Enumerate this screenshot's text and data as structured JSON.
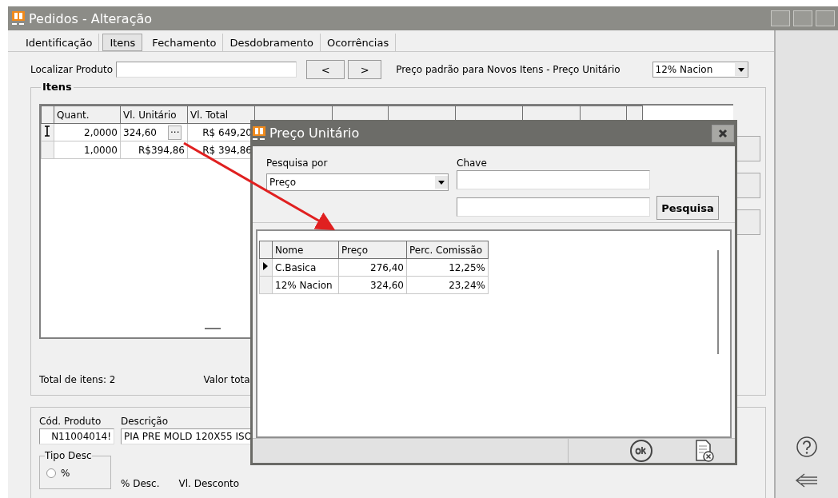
{
  "window": {
    "title": "Pedidos - Alteração"
  },
  "tabs": [
    {
      "label": "Identificação",
      "selected": false
    },
    {
      "label": "Itens",
      "selected": true
    },
    {
      "label": "Fechamento",
      "selected": false
    },
    {
      "label": "Desdobramento",
      "selected": false
    },
    {
      "label": "Ocorrências",
      "selected": false
    }
  ],
  "search": {
    "label": "Localizar Produto",
    "prev": "<",
    "next": ">",
    "price_label": "Preço padrão para Novos Itens - Preço Unitário",
    "price_value": "12% Nacion"
  },
  "items": {
    "title": "Itens",
    "columns": [
      "Quant.",
      "Vl. Unitário",
      "Vl. Total"
    ],
    "rows": [
      {
        "cells": [
          "2,0000",
          "324,60",
          "R$ 649,20"
        ],
        "selected": true,
        "ellipsis": "···"
      },
      {
        "cells": [
          "1,0000",
          "R$394,86",
          "R$ 394,86"
        ],
        "selected": false
      }
    ],
    "total_label": "Total de itens:",
    "total_value": "2",
    "value_label": "Valor tota"
  },
  "product": {
    "code_label": "Cód. Produto",
    "code": "N11004014!",
    "desc_label": "Descrição",
    "desc": "PIA PRE MOLD 120X55 ISO",
    "discount_type": "Tipo Desc",
    "options": [
      {
        "label": "%",
        "selected": false
      }
    ],
    "disc_pct": "% Desc.",
    "disc_value": "Vl. Desconto"
  },
  "dialog": {
    "title": "Preço Unitário",
    "search_by_label": "Pesquisa por",
    "search_by": "Preço",
    "key_label": "Chave",
    "search_button": "Pesquisa",
    "columns": [
      "Nome",
      "Preço",
      "Perc. Comissão"
    ],
    "rows": [
      {
        "cells": [
          "C.Basica",
          "276,40",
          "12,25%"
        ],
        "selected": true
      },
      {
        "cells": [
          "12% Nacion",
          "324,60",
          "23,24%"
        ],
        "selected": false
      }
    ]
  }
}
